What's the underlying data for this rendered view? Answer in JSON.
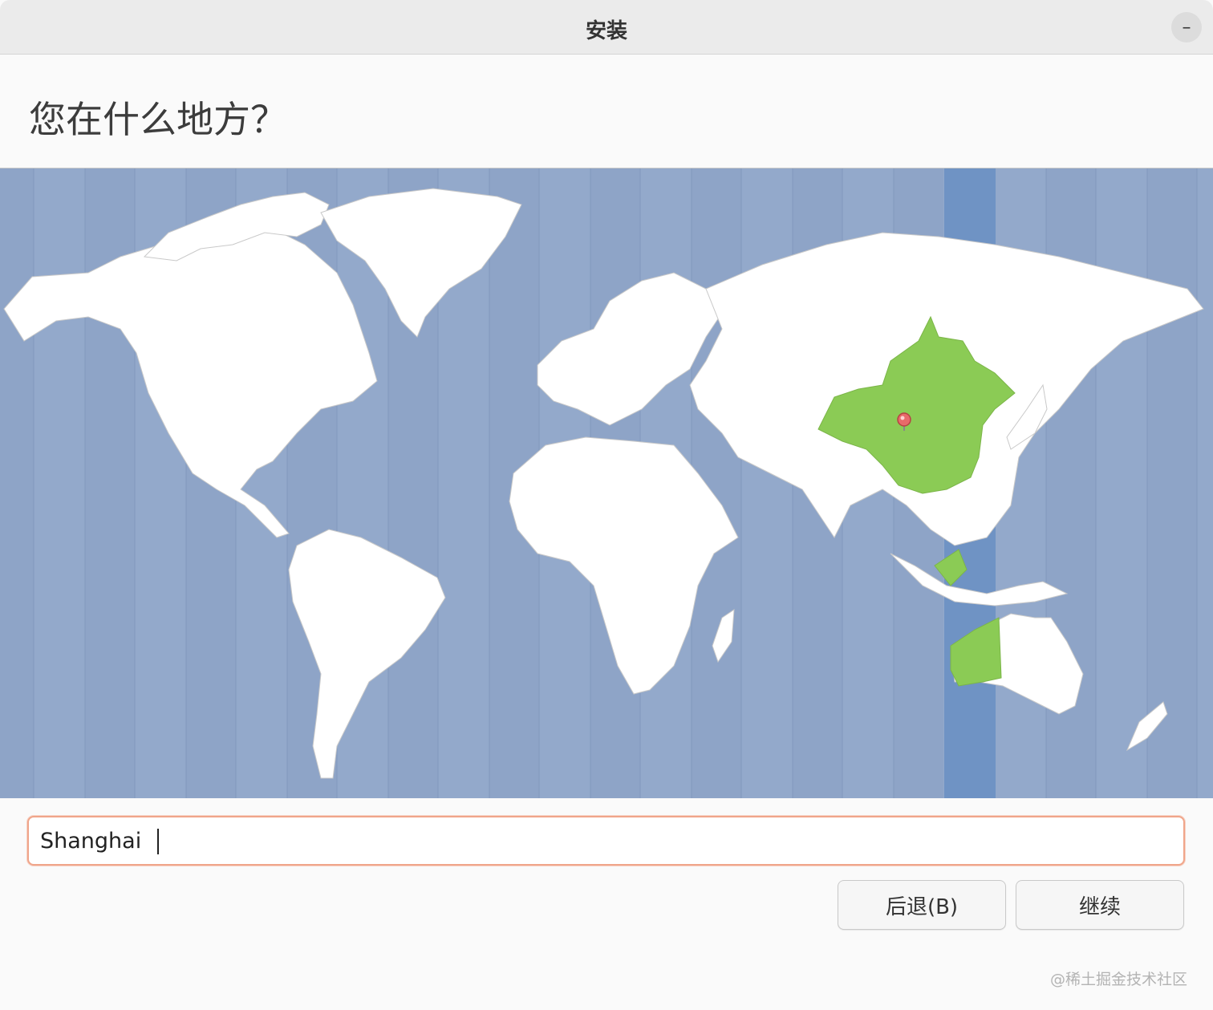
{
  "window": {
    "title": "安装",
    "minimize_symbol": "–"
  },
  "page": {
    "heading": "您在什么地方？"
  },
  "map": {
    "selected_zone_color": "#8bcb55",
    "ocean_color": "#93a9cb",
    "highlight_band_color": "#6f93c4",
    "land_color": "#ffffff",
    "pin_icon": "location-pin-icon"
  },
  "search": {
    "value": "Shanghai"
  },
  "buttons": {
    "back": "后退(B)",
    "continue": "继续"
  },
  "watermark": "@稀土掘金技术社区"
}
